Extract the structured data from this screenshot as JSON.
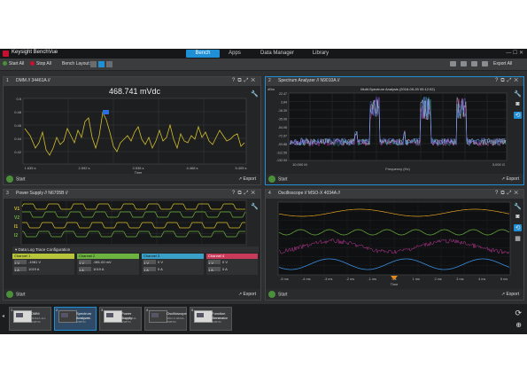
{
  "app": {
    "title": "Keysight BenchVue",
    "tabs": [
      "Bench",
      "Apps",
      "Data Manager",
      "Library"
    ],
    "active_tab": "Bench",
    "window_controls": "— ☐ ✕"
  },
  "toolbar": {
    "start_all": "Start All",
    "stop_all": "Stop All",
    "bench_layout": "Bench Layout:",
    "export_all": "Export All"
  },
  "panels": {
    "dmm": {
      "num": "1",
      "title": "DMM // 34461A //",
      "reading": "468.741 mVdc",
      "yticks": [
        "0.5",
        "0.48",
        "0.46",
        "0.44",
        "0.42"
      ],
      "xticks": [
        "1.635 s",
        "2.592 s",
        "3.536 s",
        "4.468 s",
        "5.405 s"
      ],
      "xlabel": "Time",
      "start": "Start",
      "export": "Export"
    },
    "spectrum": {
      "num": "2",
      "title": "Spectrum Analyzer // N9010A //",
      "plot_title": "Multi-Spectrum Analysis (2016-09-29 00:12:02)",
      "yunit": "dBm",
      "yticks": [
        "22.47",
        "3.84",
        "-16.39",
        "-35.06",
        "-54.06",
        "-72.97",
        "-93.88",
        "-112.55",
        "-132.94"
      ],
      "xticks": [
        "10.000 M",
        "3,000 G"
      ],
      "xlabel": "Frequency (Hz)",
      "start": "Start",
      "export": "Export"
    },
    "power": {
      "num": "3",
      "title": "Power Supply // N6705B //",
      "labels": [
        "V1",
        "V2",
        "I1",
        "I2"
      ],
      "datalog_title": "Data Log Trace Configuration",
      "channels": [
        {
          "name": "Channel 1",
          "color": "#b8c43a",
          "v_set": "1 V",
          "v_meas": "-1981 V",
          "i_set": "1 A",
          "i_meas": "1019 A"
        },
        {
          "name": "Channel 2",
          "color": "#6db33f",
          "v_set": "1 V",
          "v_meas": "-981.00 mV",
          "i_set": "1 A",
          "i_meas": "1019 A"
        },
        {
          "name": "Channel 3",
          "color": "#3aa0c8",
          "v_set": "1 V",
          "v_meas": "0 V",
          "i_set": "1 A",
          "i_meas": "0 A"
        },
        {
          "name": "Channel 4",
          "color": "#c83a5a",
          "v_set": "1 V",
          "v_meas": "0 V",
          "i_set": "1 A",
          "i_meas": "0 A"
        }
      ],
      "start": "Start",
      "export": "Export"
    },
    "scope": {
      "num": "4",
      "title": "Oscilloscope // MSO-X 4034A //",
      "xticks": [
        "-5 ms",
        "-4 ms",
        "-3 ms",
        "-2 ms",
        "-1 ms",
        "0 s",
        "1 ms",
        "2 ms",
        "3 ms",
        "4 ms",
        "5 ms"
      ],
      "xlabel": "Time",
      "start": "Start",
      "export": "Export"
    }
  },
  "tray": [
    {
      "num": "1",
      "name": "DMM",
      "sub": "34461A-111-USBTM"
    },
    {
      "num": "2",
      "name": "Spectrum Analyzer",
      "sub": "N9010A-111-USBTM"
    },
    {
      "num": "3",
      "name": "Power Supply",
      "sub": "N6705B-111-USBTM"
    },
    {
      "num": "4",
      "name": "Oscilloscope",
      "sub": "MSO-X-4034A-USBTM"
    },
    {
      "num": "5",
      "name": "Function Generator",
      "sub": "33522B-111-USBTM"
    }
  ]
}
